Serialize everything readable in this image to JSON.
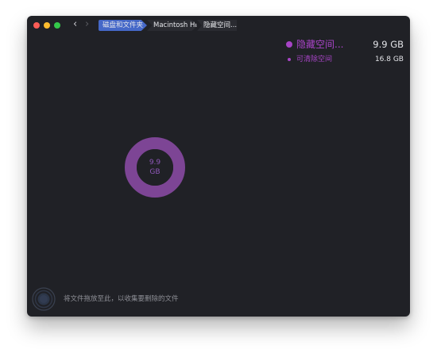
{
  "window": {
    "background": "#202126"
  },
  "toolbar": {
    "back_icon": "chevron-left-icon",
    "forward_icon": "chevron-right-icon",
    "breadcrumbs": [
      {
        "label": "磁盘和文件夹",
        "active": true
      },
      {
        "label": "Macintosh HD",
        "active": false
      },
      {
        "label": "隐藏空间...",
        "active": false
      }
    ]
  },
  "legend": [
    {
      "label": "隐藏空间...",
      "value": "9.9 GB",
      "color": "#a744c6"
    },
    {
      "label": "可清除空间",
      "value": "16.8 GB",
      "color": "#a744c6"
    }
  ],
  "donut": {
    "value": "9.9",
    "unit": "GB",
    "ring_color": "#7d4595",
    "text_color": "#8e58b8"
  },
  "drop_zone": {
    "icon": "drop-target-icon",
    "text": "将文件拖放至此，以收集要删除的文件"
  }
}
